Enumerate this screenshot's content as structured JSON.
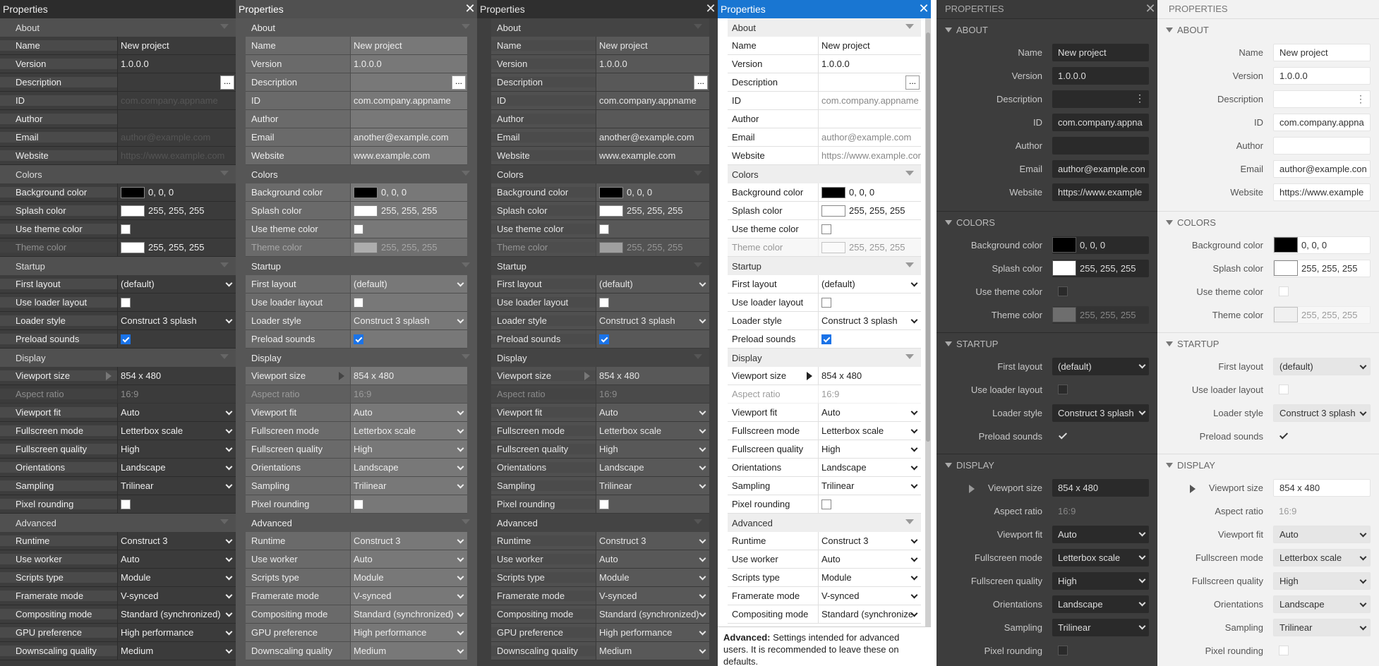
{
  "title": "Properties",
  "close_glyph": "✕",
  "dots": "...",
  "kebab": "⋮",
  "sections": {
    "about": "About",
    "colors": "Colors",
    "startup": "Startup",
    "display": "Display",
    "advanced": "Advanced"
  },
  "labels": {
    "name": "Name",
    "version": "Version",
    "description": "Description",
    "id": "ID",
    "author": "Author",
    "email": "Email",
    "website": "Website",
    "bg": "Background color",
    "splash": "Splash color",
    "use_theme": "Use theme color",
    "theme": "Theme color",
    "first_layout": "First layout",
    "use_loader": "Use loader layout",
    "loader_style": "Loader style",
    "preload": "Preload sounds",
    "viewport": "Viewport size",
    "aspect": "Aspect ratio",
    "vfit": "Viewport fit",
    "fmode": "Fullscreen mode",
    "fquality": "Fullscreen quality",
    "orient": "Orientations",
    "sampling": "Sampling",
    "pixel": "Pixel rounding",
    "runtime": "Runtime",
    "worker": "Use worker",
    "scripts": "Scripts type",
    "framerate": "Framerate mode",
    "compositing": "Compositing mode",
    "gpu": "GPU preference",
    "downscale": "Downscaling quality"
  },
  "values": {
    "name": "New project",
    "version": "1.0.0.0",
    "id_ph": "com.company.appname",
    "id_short": "com.company.appna",
    "email_ph": "author@example.com",
    "email_short": "author@example.con",
    "email2": "another@example.com",
    "web_ph": "https://www.example.com",
    "web_p4": "https://www.example.cor",
    "web_short": "https://www.example",
    "web2": "www.example.com",
    "bg": "0, 0, 0",
    "white": "255, 255, 255",
    "first_layout": "(default)",
    "loader_style": "Construct 3 splash",
    "viewport": "854 x 480",
    "aspect": "16:9",
    "vfit": "Auto",
    "fmode": "Letterbox scale",
    "fquality": "High",
    "orient": "Landscape",
    "sampling": "Trilinear",
    "runtime": "Construct 3",
    "worker": "Auto",
    "scripts": "Module",
    "framerate": "V-synced",
    "compositing": "Standard (synchronized)",
    "compositing_short": "Standard (synchronize",
    "gpu": "High performance",
    "downscale": "Medium"
  },
  "footer": {
    "bold": "Advanced:",
    "text": " Settings intended for advanced users. It is recommended to leave these on defaults."
  },
  "colors": {
    "accent": "#1976d2",
    "check": "#1a73e8"
  }
}
